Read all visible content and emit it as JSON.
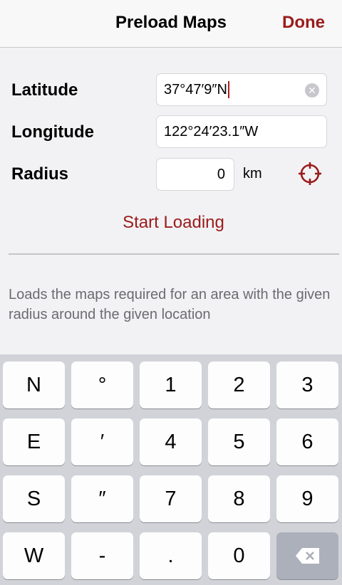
{
  "navbar": {
    "title": "Preload Maps",
    "done_label": "Done"
  },
  "form": {
    "latitude_label": "Latitude",
    "latitude_value": "37°47′9″N",
    "longitude_label": "Longitude",
    "longitude_value": "122°24′23.1″W",
    "radius_label": "Radius",
    "radius_value": "0",
    "radius_unit": "km"
  },
  "actions": {
    "start_label": "Start Loading"
  },
  "help_text": "Loads the maps required for an area with the given radius around the given location",
  "keyboard": {
    "row1": [
      "N",
      "°",
      "1",
      "2",
      "3"
    ],
    "row2": [
      "E",
      "′",
      "4",
      "5",
      "6"
    ],
    "row3": [
      "S",
      "″",
      "7",
      "8",
      "9"
    ],
    "row4": [
      "W",
      "-",
      ".",
      "0"
    ]
  },
  "icons": {
    "locate": "crosshair-icon",
    "clear": "clear-icon",
    "backspace": "backspace-icon"
  },
  "colors": {
    "accent": "#9b1b1b",
    "keyboard_bg": "#d1d3d9",
    "key_bg": "#fdfdfd",
    "key_dark": "#abb0ba"
  }
}
